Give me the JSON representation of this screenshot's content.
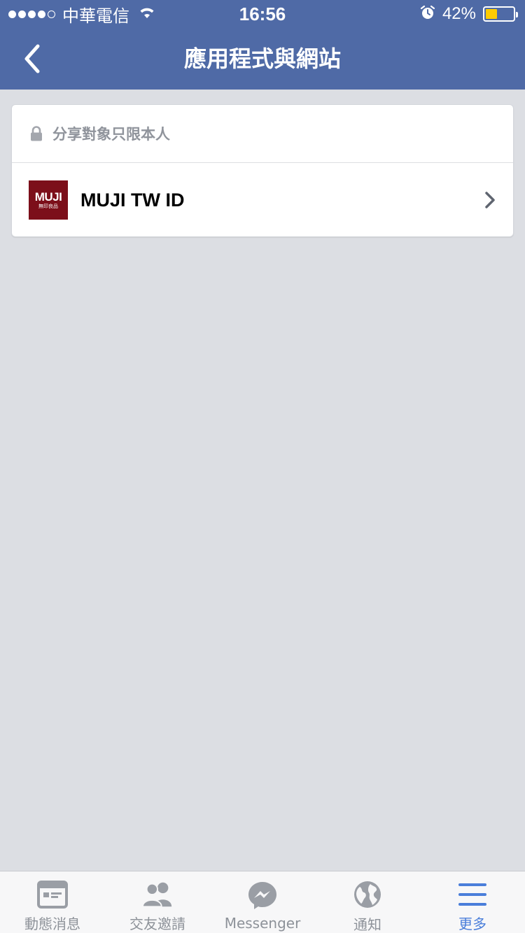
{
  "status_bar": {
    "carrier": "中華電信",
    "time": "16:56",
    "battery_percent": "42%",
    "battery_level": 0.42
  },
  "nav": {
    "title": "應用程式與網站",
    "back_icon": "chevron-left-icon"
  },
  "privacy": {
    "icon": "lock-icon",
    "text": "分享對象只限本人"
  },
  "apps": [
    {
      "logo_text": "MUJI",
      "logo_subtext": "無印良品",
      "name": "MUJI TW ID",
      "logo_color": "#7c0f1a"
    }
  ],
  "tabs": [
    {
      "label": "動態消息",
      "icon": "news-feed-icon",
      "active": false
    },
    {
      "label": "交友邀請",
      "icon": "friends-icon",
      "active": false
    },
    {
      "label": "Messenger",
      "icon": "messenger-icon",
      "active": false
    },
    {
      "label": "通知",
      "icon": "globe-icon",
      "active": false
    },
    {
      "label": "更多",
      "icon": "menu-icon",
      "active": true
    }
  ],
  "colors": {
    "header": "#4f6aa6",
    "background": "#dcdee3",
    "active_tab": "#4a7eda",
    "inactive_tab": "#8d9299",
    "battery_fill": "#ffcc00"
  }
}
